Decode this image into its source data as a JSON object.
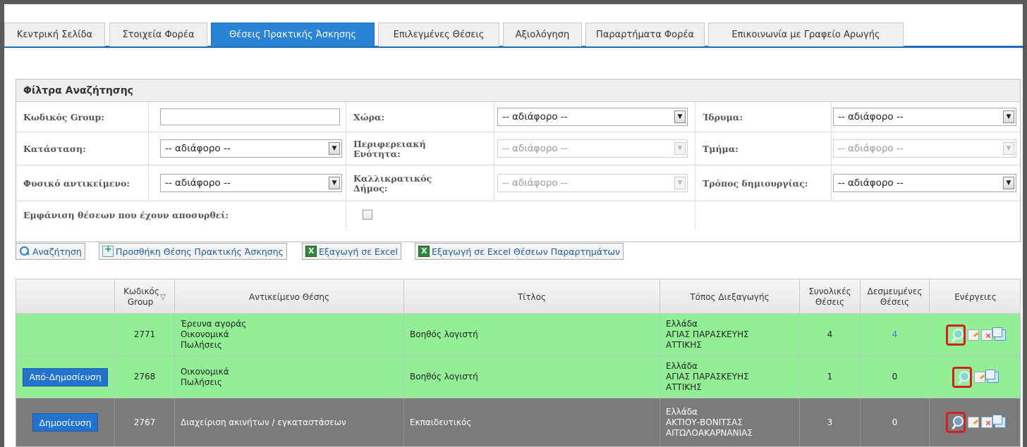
{
  "tabs": [
    {
      "label": "Κεντρική Σελίδα",
      "active": false
    },
    {
      "label": "Στοιχεία Φορέα",
      "active": false
    },
    {
      "label": "Θέσεις Πρακτικής Άσκησης",
      "active": true
    },
    {
      "label": "Επιλεγμένες Θέσεις",
      "active": false
    },
    {
      "label": "Αξιολόγηση",
      "active": false
    },
    {
      "label": "Παραρτήματα Φορέα",
      "active": false
    },
    {
      "label": "Επικοινωνία με Γραφείο Αρωγής",
      "active": false
    }
  ],
  "filters": {
    "title": "Φίλτρα Αναζήτησης",
    "group_code_label": "Κωδικός Group:",
    "group_code_value": "",
    "country_label": "Χώρα:",
    "country_value": "-- αδιάφορο --",
    "institution_label": "Ίδρυμα:",
    "institution_value": "-- αδιάφορο --",
    "status_label": "Κατάσταση:",
    "status_value": "-- αδιάφορο --",
    "regional_unit_label": "Περιφερειακή Ενότητα:",
    "regional_unit_value": "-- αδιάφορο --",
    "department_label": "Τμήμα:",
    "department_value": "-- αδιάφορο --",
    "physical_object_label": "Φυσικό αντικείμενο:",
    "physical_object_value": "-- αδιάφορο --",
    "municipality_label": "Καλλικρατικός Δήμος:",
    "municipality_value": "-- αδιάφορο --",
    "creation_method_label": "Τρόπος δημιουργίας:",
    "creation_method_value": "-- αδιάφορο --",
    "show_withdrawn_label": "Εμφάνιση θέσεων που έχουν αποσυρθεί:",
    "show_withdrawn_checked": false
  },
  "toolbar": {
    "search_label": "Αναζήτηση",
    "add_label": "Προσθήκη Θέσης Πρακτικής Άσκησης",
    "export_label": "Εξαγωγή σε Excel",
    "export_annex_label": "Εξαγωγή σε Excel Θέσεων Παραρτημάτων"
  },
  "table": {
    "headers": {
      "group_code": "Κωδικός Group",
      "subject": "Αντικείμενο Θέσης",
      "title": "Τίτλος",
      "location": "Τόπος Διεξαγωγής",
      "total": "Συνολικές Θέσεις",
      "reserved": "Δεσμευμένες Θέσεις",
      "actions": "Ενέργειες"
    },
    "rows": [
      {
        "status_button": "",
        "group_code": "2771",
        "subject": [
          "Έρευνα αγοράς",
          "Οικονομικά",
          "Πωλήσεις"
        ],
        "title": "Βοηθός λογιστή",
        "location": [
          "Ελλάδα",
          "ΑΓΙΑΣ ΠΑΡΑΣΚΕΥΗΣ",
          "ΑΤΤΙΚΗΣ"
        ],
        "total": "4",
        "reserved": "4",
        "color": "#93ef95",
        "actions": [
          "view-icon",
          "edit-icon",
          "delete-icon",
          "copy-icon"
        ]
      },
      {
        "status_button": "Από-Δημοσίευση",
        "group_code": "2768",
        "subject": [
          "Οικονομικά",
          "Πωλήσεις"
        ],
        "title": "Βοηθός λογιστή",
        "location": [
          "Ελλάδα",
          "ΑΓΙΑΣ ΠΑΡΑΣΚΕΥΗΣ",
          "ΑΤΤΙΚΗΣ"
        ],
        "total": "1",
        "reserved": "0",
        "color": "#93ef95",
        "actions": [
          "view-icon",
          "edit-icon",
          "copy-icon"
        ]
      },
      {
        "status_button": "Δημοσίευση",
        "group_code": "2767",
        "subject": [
          "Διαχείριση ακινήτων / εγκαταστάσεων"
        ],
        "title": "Εκπαιδευτικός",
        "location": [
          "Ελλάδα",
          "ΑΚΤΙΟΥ-ΒΟΝΙΤΣΑΣ",
          "ΑΙΤΩΛΟΑΚΑΡΝΑΝΙΑΣ"
        ],
        "total": "3",
        "reserved": "0",
        "color": "#7b7b7b",
        "actions": [
          "view-icon",
          "edit-icon",
          "delete-icon",
          "copy-icon"
        ]
      }
    ]
  },
  "colors": {
    "accent": "#2a83d4",
    "row_active": "#93ef95",
    "row_unpublished": "#7b7b7b",
    "highlight_border": "#d62020"
  }
}
